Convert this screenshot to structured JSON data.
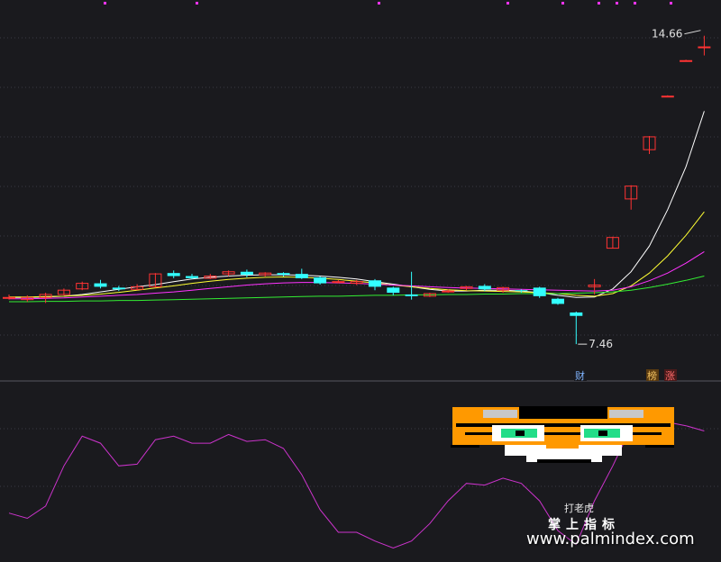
{
  "chart_data": [
    {
      "type": "candlestick",
      "panel": "price",
      "annotations": {
        "high_label": "14.66",
        "low_label": "7.46"
      },
      "badges": [
        {
          "text": "财",
          "color": "#7fb4ff",
          "bg": "#1a1a1e"
        },
        {
          "text": "榜",
          "color": "#f0c060",
          "bg": "#5a3a10"
        },
        {
          "text": "涨",
          "color": "#ff6b6b",
          "bg": "#4a1a1a"
        }
      ],
      "ylim": [
        7.0,
        15.2
      ],
      "candles": [
        {
          "o": 8.55,
          "c": 8.55,
          "h": 8.62,
          "l": 8.5
        },
        {
          "o": 8.5,
          "c": 8.55,
          "h": 8.6,
          "l": 8.45
        },
        {
          "o": 8.55,
          "c": 8.62,
          "h": 8.66,
          "l": 8.42
        },
        {
          "o": 8.62,
          "c": 8.72,
          "h": 8.76,
          "l": 8.6
        },
        {
          "o": 8.75,
          "c": 8.88,
          "h": 8.92,
          "l": 8.72
        },
        {
          "o": 8.88,
          "c": 8.8,
          "h": 8.96,
          "l": 8.76
        },
        {
          "o": 8.78,
          "c": 8.74,
          "h": 8.82,
          "l": 8.7
        },
        {
          "o": 8.74,
          "c": 8.8,
          "h": 8.86,
          "l": 8.72
        },
        {
          "o": 8.8,
          "c": 9.1,
          "h": 9.12,
          "l": 8.78
        },
        {
          "o": 9.12,
          "c": 9.05,
          "h": 9.18,
          "l": 9.0
        },
        {
          "o": 9.05,
          "c": 9.0,
          "h": 9.1,
          "l": 8.98
        },
        {
          "o": 9.0,
          "c": 9.05,
          "h": 9.1,
          "l": 8.98
        },
        {
          "o": 9.1,
          "c": 9.15,
          "h": 9.18,
          "l": 9.05
        },
        {
          "o": 9.15,
          "c": 9.08,
          "h": 9.2,
          "l": 9.02
        },
        {
          "o": 9.08,
          "c": 9.12,
          "h": 9.14,
          "l": 9.04
        },
        {
          "o": 9.12,
          "c": 9.08,
          "h": 9.14,
          "l": 9.04
        },
        {
          "o": 9.1,
          "c": 9.0,
          "h": 9.22,
          "l": 8.98
        },
        {
          "o": 9.02,
          "c": 8.88,
          "h": 9.04,
          "l": 8.85
        },
        {
          "o": 8.9,
          "c": 8.92,
          "h": 8.96,
          "l": 8.88
        },
        {
          "o": 8.88,
          "c": 8.92,
          "h": 8.96,
          "l": 8.84
        },
        {
          "o": 8.95,
          "c": 8.8,
          "h": 8.98,
          "l": 8.72
        },
        {
          "o": 8.78,
          "c": 8.66,
          "h": 8.8,
          "l": 8.6
        },
        {
          "o": 8.62,
          "c": 8.58,
          "h": 9.15,
          "l": 8.5
        },
        {
          "o": 8.58,
          "c": 8.64,
          "h": 8.66,
          "l": 8.56
        },
        {
          "o": 8.7,
          "c": 8.7,
          "h": 8.74,
          "l": 8.66
        },
        {
          "o": 8.76,
          "c": 8.8,
          "h": 8.82,
          "l": 8.72
        },
        {
          "o": 8.82,
          "c": 8.74,
          "h": 8.86,
          "l": 8.7
        },
        {
          "o": 8.72,
          "c": 8.78,
          "h": 8.8,
          "l": 8.66
        },
        {
          "o": 8.72,
          "c": 8.7,
          "h": 8.74,
          "l": 8.66
        },
        {
          "o": 8.78,
          "c": 8.58,
          "h": 8.8,
          "l": 8.54
        },
        {
          "o": 8.52,
          "c": 8.4,
          "h": 8.54,
          "l": 8.38
        },
        {
          "o": 8.2,
          "c": 8.12,
          "h": 8.22,
          "l": 7.46
        },
        {
          "o": 8.8,
          "c": 8.84,
          "h": 8.98,
          "l": 8.62
        },
        {
          "o": 9.7,
          "c": 9.95,
          "h": 9.97,
          "l": 9.7
        },
        {
          "o": 10.85,
          "c": 11.15,
          "h": 11.17,
          "l": 10.6
        },
        {
          "o": 12.0,
          "c": 12.3,
          "h": 12.32,
          "l": 11.9
        },
        {
          "o": 13.25,
          "c": 13.25,
          "h": 13.27,
          "l": 13.23
        },
        {
          "o": 14.08,
          "c": 14.08,
          "h": 14.1,
          "l": 14.06
        },
        {
          "o": 14.4,
          "c": 14.4,
          "h": 14.66,
          "l": 14.2
        }
      ],
      "ma_lines": [
        {
          "name": "white",
          "color": "#ffffff",
          "values": [
            8.55,
            8.55,
            8.56,
            8.58,
            8.62,
            8.68,
            8.74,
            8.8,
            8.85,
            8.92,
            8.98,
            9.02,
            9.05,
            9.07,
            9.08,
            9.08,
            9.07,
            9.05,
            9.02,
            8.98,
            8.92,
            8.86,
            8.8,
            8.74,
            8.7,
            8.7,
            8.72,
            8.72,
            8.7,
            8.66,
            8.6,
            8.55,
            8.56,
            8.75,
            9.15,
            9.75,
            10.6,
            11.6,
            12.9
          ]
        },
        {
          "name": "yellow",
          "color": "#ffff33",
          "values": [
            8.56,
            8.56,
            8.57,
            8.58,
            8.6,
            8.63,
            8.67,
            8.72,
            8.77,
            8.82,
            8.88,
            8.93,
            8.97,
            9.0,
            9.02,
            9.03,
            9.02,
            9.0,
            8.97,
            8.93,
            8.89,
            8.84,
            8.8,
            8.76,
            8.73,
            8.71,
            8.7,
            8.69,
            8.68,
            8.66,
            8.64,
            8.6,
            8.58,
            8.64,
            8.82,
            9.12,
            9.52,
            10.0,
            10.55
          ]
        },
        {
          "name": "magenta",
          "color": "#ff33ff",
          "values": [
            8.52,
            8.52,
            8.53,
            8.54,
            8.56,
            8.58,
            8.6,
            8.62,
            8.65,
            8.68,
            8.72,
            8.76,
            8.8,
            8.84,
            8.87,
            8.89,
            8.9,
            8.9,
            8.89,
            8.88,
            8.86,
            8.84,
            8.82,
            8.8,
            8.78,
            8.77,
            8.76,
            8.75,
            8.74,
            8.73,
            8.72,
            8.71,
            8.7,
            8.72,
            8.8,
            8.94,
            9.12,
            9.35,
            9.62
          ]
        },
        {
          "name": "green",
          "color": "#33ee33",
          "values": [
            8.45,
            8.45,
            8.46,
            8.46,
            8.47,
            8.47,
            8.48,
            8.48,
            8.49,
            8.5,
            8.51,
            8.52,
            8.53,
            8.54,
            8.55,
            8.56,
            8.57,
            8.58,
            8.58,
            8.59,
            8.6,
            8.6,
            8.61,
            8.61,
            8.62,
            8.62,
            8.63,
            8.63,
            8.64,
            8.64,
            8.64,
            8.65,
            8.66,
            8.68,
            8.72,
            8.78,
            8.86,
            8.95,
            9.05
          ]
        }
      ]
    },
    {
      "type": "line",
      "panel": "indicator",
      "name": "打老虎",
      "color": "#cc33cc",
      "ylim": [
        0,
        100
      ],
      "values": [
        28,
        25,
        32,
        55,
        72,
        68,
        55,
        56,
        70,
        72,
        68,
        68,
        73,
        69,
        70,
        65,
        50,
        30,
        17,
        17,
        12,
        8,
        12,
        22,
        35,
        45,
        44,
        48,
        45,
        35,
        18,
        10,
        35,
        55,
        77,
        80,
        80,
        78,
        75
      ]
    }
  ],
  "watermark": {
    "brand_cn": "掌上指标",
    "url": "www.palmindex.com"
  }
}
